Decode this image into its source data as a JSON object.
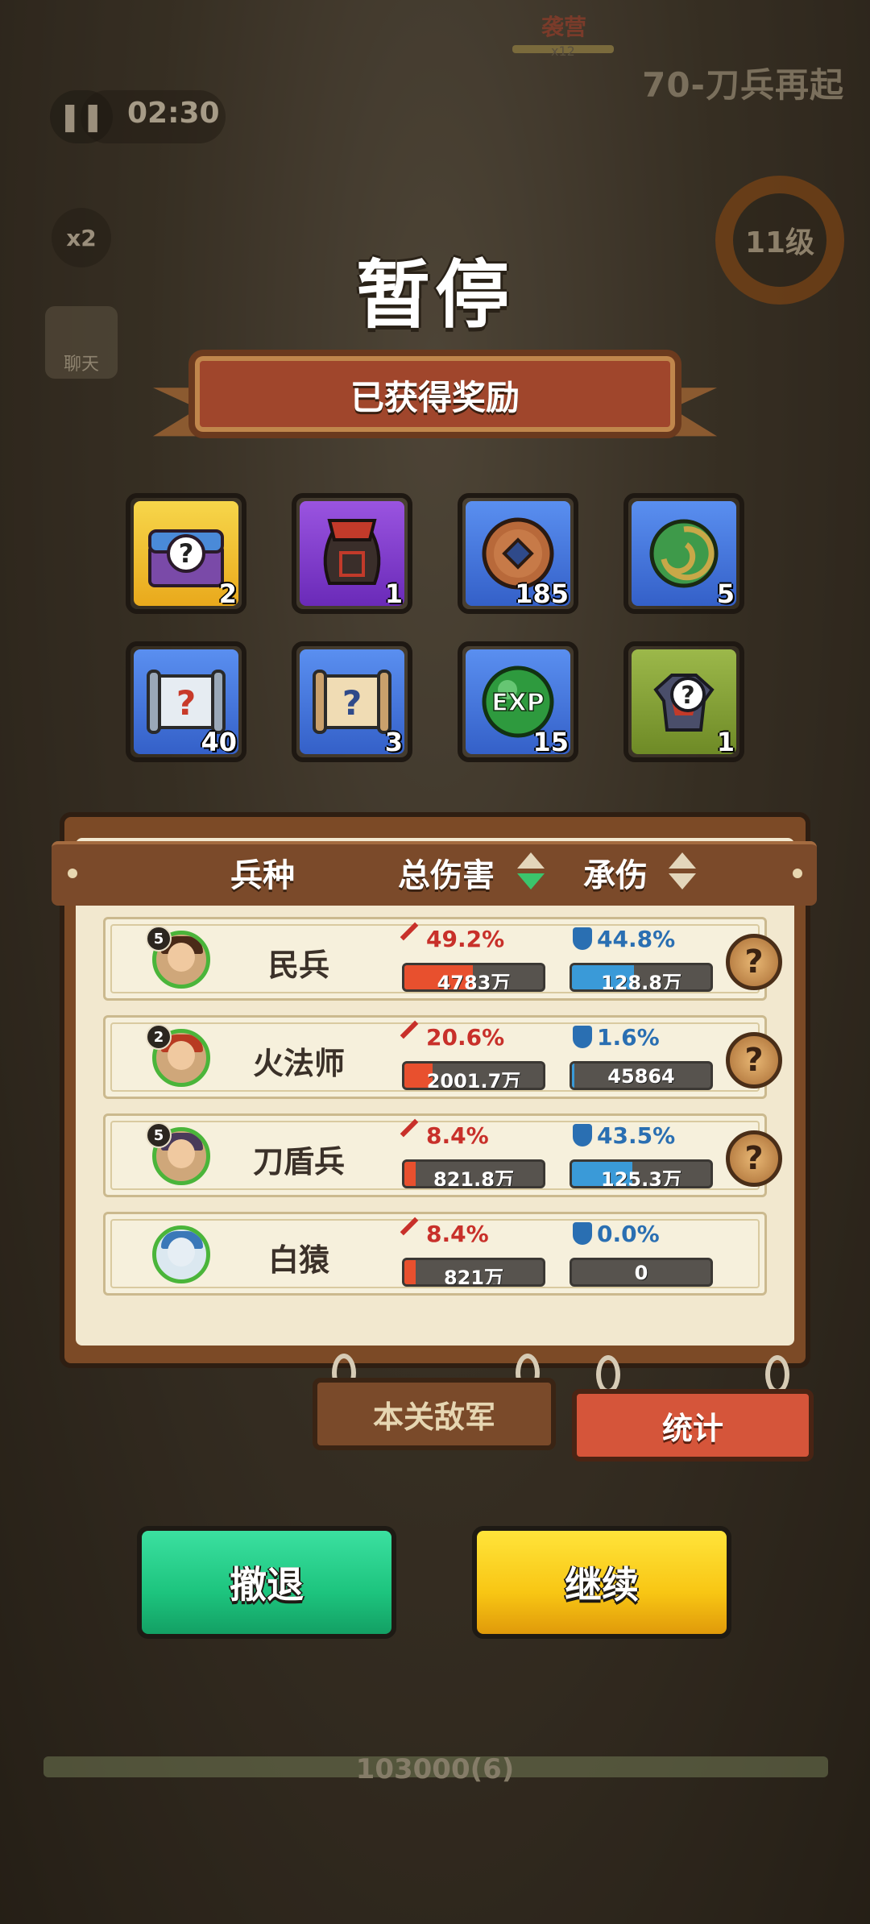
{
  "hud": {
    "timer": "02:30",
    "speed": "x2",
    "chat": "聊天",
    "stage": "70-刀兵再起",
    "boss_name": "袭营",
    "boss_mult": "x12",
    "level": "11级",
    "base_hp": "103000(6)"
  },
  "pause": {
    "title": "暂停",
    "reward_banner": "已获得奖励"
  },
  "rewards": [
    {
      "icon": "mystery-chest-icon",
      "count": "2",
      "quality": "gold"
    },
    {
      "icon": "wine-jar-icon",
      "count": "1",
      "quality": "purple"
    },
    {
      "icon": "copper-coin-icon",
      "count": "185",
      "quality": "blue"
    },
    {
      "icon": "jade-swirl-icon",
      "count": "5",
      "quality": "blue"
    },
    {
      "icon": "mystery-scroll-icon",
      "count": "40",
      "quality": "blue"
    },
    {
      "icon": "scroll-icon",
      "count": "3",
      "quality": "blue"
    },
    {
      "icon": "exp-orb-icon",
      "count": "15",
      "quality": "blue",
      "label": "EXP"
    },
    {
      "icon": "mystery-armor-icon",
      "count": "1",
      "quality": "green"
    }
  ],
  "table": {
    "col_unit": "兵种",
    "col_damage": "总伤害",
    "col_tank": "承伤",
    "rows": [
      {
        "level": "5",
        "name": "民兵",
        "dmg_pct": "49.2%",
        "dmg_val": "4783万",
        "dmg_fill": 0.492,
        "tank_pct": "44.8%",
        "tank_val": "128.8万",
        "tank_fill": 0.448,
        "help": "?"
      },
      {
        "level": "2",
        "name": "火法师",
        "dmg_pct": "20.6%",
        "dmg_val": "2001.7万",
        "dmg_fill": 0.206,
        "tank_pct": "1.6%",
        "tank_val": "45864",
        "tank_fill": 0.016,
        "help": "?"
      },
      {
        "level": "5",
        "name": "刀盾兵",
        "dmg_pct": "8.4%",
        "dmg_val": "821.8万",
        "dmg_fill": 0.084,
        "tank_pct": "43.5%",
        "tank_val": "125.3万",
        "tank_fill": 0.435,
        "help": "?"
      },
      {
        "level": "",
        "name": "白猿",
        "dmg_pct": "8.4%",
        "dmg_val": "821万",
        "dmg_fill": 0.084,
        "tank_pct": "0.0%",
        "tank_val": "0",
        "tank_fill": 0.0,
        "help": ""
      }
    ]
  },
  "tabs": {
    "enemy": "本关敌军",
    "stats": "统计"
  },
  "buttons": {
    "retreat": "撤退",
    "continue": "继续"
  }
}
